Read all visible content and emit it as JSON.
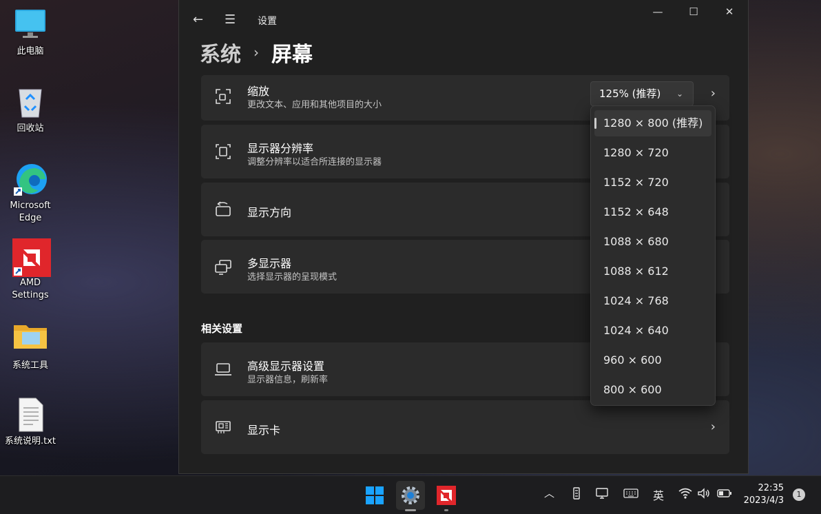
{
  "desktop": {
    "icons": [
      {
        "label": "此电脑",
        "icon": "monitor-icon"
      },
      {
        "label": "回收站",
        "icon": "recycle-bin-icon"
      },
      {
        "label": "Microsoft Edge",
        "icon": "edge-icon"
      },
      {
        "label": "AMD Settings",
        "icon": "amd-icon"
      },
      {
        "label": "系统工具",
        "icon": "folder-icon"
      },
      {
        "label": "系统说明.txt",
        "icon": "text-file-icon"
      }
    ]
  },
  "window": {
    "app_title": "设置",
    "back_icon": "←",
    "menu_icon": "☰",
    "controls": {
      "minimize": "—",
      "maximize": "☐",
      "close": "✕"
    },
    "breadcrumb": {
      "parent": "系统",
      "separator": "›",
      "current": "屏幕"
    }
  },
  "cards": {
    "scale": {
      "title": "缩放",
      "subtitle": "更改文本、应用和其他项目的大小",
      "value": "125% (推荐)",
      "chevron": "›"
    },
    "resolution": {
      "title": "显示器分辨率",
      "subtitle": "调整分辨率以适合所连接的显示器"
    },
    "orientation": {
      "title": "显示方向"
    },
    "multi_display": {
      "title": "多显示器",
      "subtitle": "选择显示器的呈现模式"
    },
    "related_header": "相关设置",
    "advanced": {
      "title": "高级显示器设置",
      "subtitle": "显示器信息，刷新率"
    },
    "graphics": {
      "title": "显示卡",
      "chevron": "›"
    }
  },
  "resolution_dropdown": {
    "selected_index": 0,
    "options": [
      "1280 × 800 (推荐)",
      "1280 × 720",
      "1152 × 720",
      "1152 × 648",
      "1088 × 680",
      "1088 × 612",
      "1024 × 768",
      "1024 × 640",
      "960 × 600",
      "800 × 600"
    ]
  },
  "taskbar": {
    "apps": [
      {
        "name": "start-button",
        "icon": "windows-logo-icon"
      },
      {
        "name": "settings-app",
        "icon": "gear-icon",
        "active": true
      },
      {
        "name": "amd-app",
        "icon": "amd-icon"
      }
    ],
    "tray": {
      "overflow": "︿",
      "ime": "英"
    },
    "clock": {
      "time": "22:35",
      "date": "2023/4/3"
    },
    "notifications": "1"
  },
  "colors": {
    "accent": "#0078d4",
    "amd_red": "#e0262b",
    "card_bg": "#2b2b2b",
    "window_bg": "#202020"
  }
}
